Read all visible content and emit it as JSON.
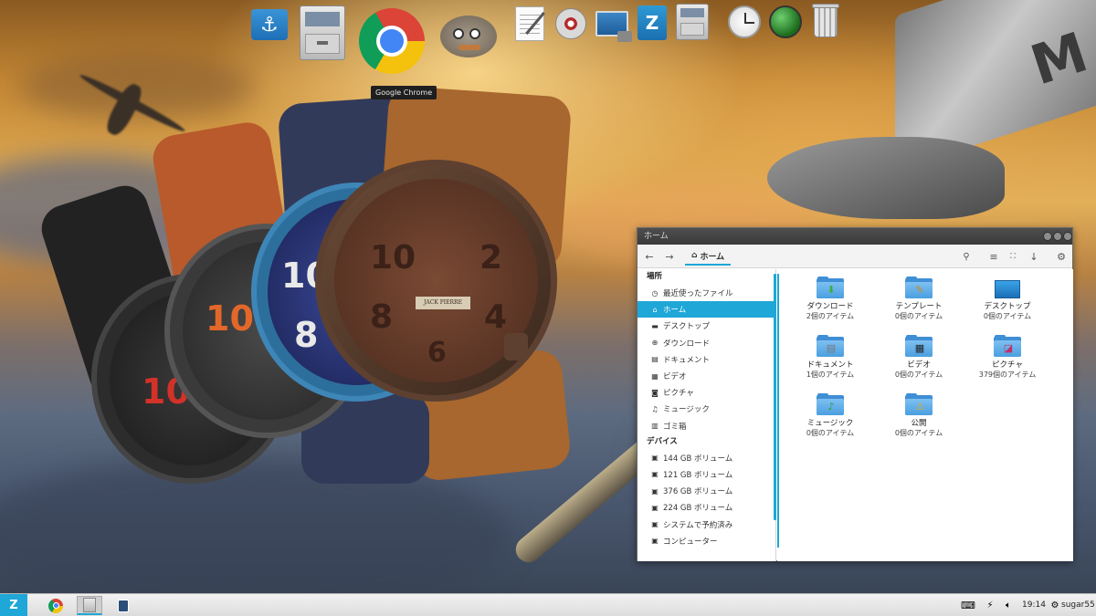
{
  "dock": {
    "items": [
      {
        "name": "anchor"
      },
      {
        "name": "file-cabinet"
      },
      {
        "name": "google-chrome"
      },
      {
        "name": "gimp"
      },
      {
        "name": "text-editor"
      },
      {
        "name": "disc-burner"
      },
      {
        "name": "screenshot"
      },
      {
        "name": "software-store"
      },
      {
        "name": "file-cabinet-small"
      },
      {
        "name": "clock"
      },
      {
        "name": "green-orb"
      },
      {
        "name": "trash"
      }
    ],
    "tooltip": "Google Chrome"
  },
  "window": {
    "title": "ホーム",
    "location_label": "ホーム"
  },
  "sidebar": {
    "places_header": "場所",
    "places": [
      {
        "label": "最近使ったファイル",
        "icon": "clock-icon"
      },
      {
        "label": "ホーム",
        "icon": "home-icon",
        "active": true
      },
      {
        "label": "デスクトップ",
        "icon": "folder-icon"
      },
      {
        "label": "ダウンロード",
        "icon": "download-icon"
      },
      {
        "label": "ドキュメント",
        "icon": "document-icon"
      },
      {
        "label": "ビデオ",
        "icon": "film-icon"
      },
      {
        "label": "ピクチャ",
        "icon": "camera-icon"
      },
      {
        "label": "ミュージック",
        "icon": "music-icon"
      },
      {
        "label": "ゴミ箱",
        "icon": "trash-icon"
      }
    ],
    "devices_header": "デバイス",
    "devices": [
      {
        "label": "144 GB ボリューム",
        "icon": "drive-icon"
      },
      {
        "label": "121 GB ボリューム",
        "icon": "drive-icon"
      },
      {
        "label": "376 GB ボリューム",
        "icon": "drive-icon"
      },
      {
        "label": "224 GB ボリューム",
        "icon": "drive-icon"
      },
      {
        "label": "システムで予約済み",
        "icon": "drive-icon"
      },
      {
        "label": "コンピューター",
        "icon": "drive-icon"
      }
    ]
  },
  "files": [
    {
      "name": "ダウンロード",
      "count": "2個のアイテム",
      "emblem": "download"
    },
    {
      "name": "テンプレート",
      "count": "0個のアイテム",
      "emblem": "pencil"
    },
    {
      "name": "デスクトップ",
      "count": "0個のアイテム",
      "emblem": "desktop"
    },
    {
      "name": "ドキュメント",
      "count": "1個のアイテム",
      "emblem": "document"
    },
    {
      "name": "ビデオ",
      "count": "0個のアイテム",
      "emblem": "film"
    },
    {
      "name": "ピクチャ",
      "count": "379個のアイテム",
      "emblem": "picture"
    },
    {
      "name": "ミュージック",
      "count": "0個のアイテム",
      "emblem": "music"
    },
    {
      "name": "公開",
      "count": "0個のアイテム",
      "emblem": "share"
    }
  ],
  "taskbar": {
    "time": "19:14",
    "user": "sugar55"
  },
  "colors": {
    "accent": "#1ea7d7"
  }
}
